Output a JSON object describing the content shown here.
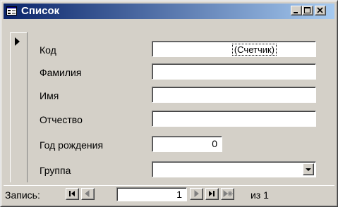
{
  "window": {
    "title": "Список",
    "icon": "form-icon",
    "controls": [
      "minimize-icon",
      "maximize-icon",
      "close-icon"
    ]
  },
  "form": {
    "fields": [
      {
        "label": "Код",
        "value": "",
        "autonumber_text": "(Счетчик)"
      },
      {
        "label": "Фамилия",
        "value": ""
      },
      {
        "label": "Имя",
        "value": ""
      },
      {
        "label": "Отчество",
        "value": ""
      },
      {
        "label": "Год рождения",
        "value": "0"
      },
      {
        "label": "Группа",
        "value": ""
      }
    ],
    "record_selector_icon": "current-record-arrow-icon"
  },
  "navigation": {
    "label": "Запись:",
    "current": "1",
    "total_text": "из 1",
    "buttons": [
      "first-record-icon",
      "previous-record-icon",
      "next-record-icon",
      "last-record-icon",
      "new-record-icon"
    ]
  },
  "colors": {
    "title_gradient_start": "#0a246a",
    "title_gradient_end": "#a6caf0",
    "face": "#d4d0c8"
  }
}
